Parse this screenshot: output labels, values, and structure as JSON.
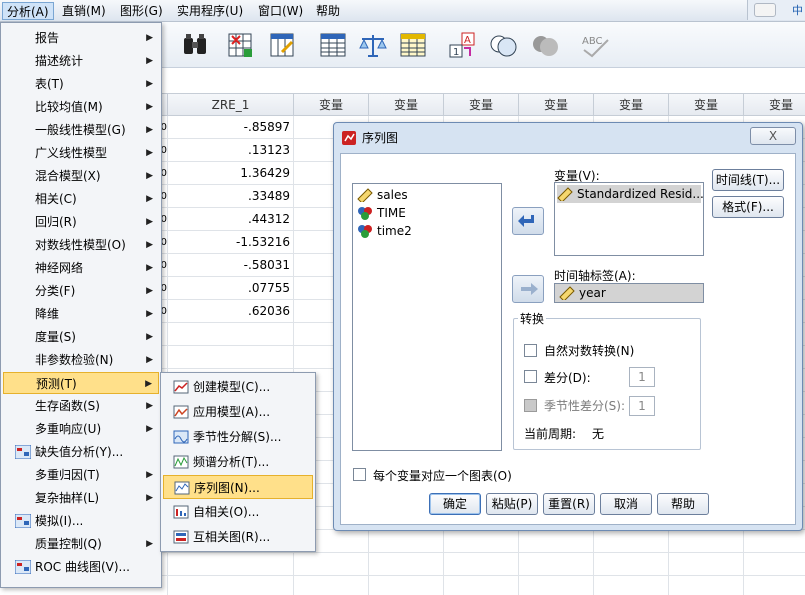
{
  "menubar": {
    "items": [
      {
        "label": "分析(A)"
      },
      {
        "label": "直销(M)"
      },
      {
        "label": "图形(G)"
      },
      {
        "label": "实用程序(U)"
      },
      {
        "label": "窗口(W)"
      },
      {
        "label": "帮助"
      }
    ],
    "right_tag": "中"
  },
  "grid": {
    "columns": [
      "ZRE_1",
      "变量",
      "变量",
      "变量",
      "变量",
      "变量",
      "变量",
      "变量"
    ],
    "zre_values": [
      "-.85897",
      ".13123",
      "1.36429",
      ".33489",
      ".44312",
      "-1.53216",
      "-.58031",
      ".07755",
      ".62036"
    ],
    "left_col_values": [
      "0",
      "0",
      "0",
      "0",
      "0",
      "0",
      "0",
      "0",
      "0"
    ]
  },
  "analyze_menu": {
    "items": [
      {
        "label": "报告",
        "submenu": true
      },
      {
        "label": "描述统计",
        "submenu": true
      },
      {
        "label": "表(T)",
        "submenu": true
      },
      {
        "label": "比较均值(M)",
        "submenu": true
      },
      {
        "label": "一般线性模型(G)",
        "submenu": true
      },
      {
        "label": "广义线性模型",
        "submenu": true
      },
      {
        "label": "混合模型(X)",
        "submenu": true
      },
      {
        "label": "相关(C)",
        "submenu": true
      },
      {
        "label": "回归(R)",
        "submenu": true
      },
      {
        "label": "对数线性模型(O)",
        "submenu": true
      },
      {
        "label": "神经网络",
        "submenu": true
      },
      {
        "label": "分类(F)",
        "submenu": true
      },
      {
        "label": "降维",
        "submenu": true
      },
      {
        "label": "度量(S)",
        "submenu": true
      },
      {
        "label": "非参数检验(N)",
        "submenu": true
      },
      {
        "label": "预测(T)",
        "submenu": true
      },
      {
        "label": "生存函数(S)",
        "submenu": true
      },
      {
        "label": "多重响应(U)",
        "submenu": true
      },
      {
        "label": "缺失值分析(Y)...",
        "submenu": false
      },
      {
        "label": "多重归因(T)",
        "submenu": true
      },
      {
        "label": "复杂抽样(L)",
        "submenu": true
      },
      {
        "label": "模拟(I)...",
        "submenu": false
      },
      {
        "label": "质量控制(Q)",
        "submenu": true
      },
      {
        "label": "ROC 曲线图(V)...",
        "submenu": false
      }
    ]
  },
  "forecast_submenu": {
    "items": [
      {
        "label": "创建模型(C)..."
      },
      {
        "label": "应用模型(A)..."
      },
      {
        "label": "季节性分解(S)..."
      },
      {
        "label": "频谱分析(T)..."
      },
      {
        "label": "序列图(N)..."
      },
      {
        "label": "自相关(O)..."
      },
      {
        "label": "互相关图(R)..."
      }
    ]
  },
  "dialog": {
    "title": "序列图",
    "close_label": "X",
    "source_vars": [
      "sales",
      "TIME",
      "time2"
    ],
    "variables_label": "变量(V):",
    "variables_value": "Standardized Resid...",
    "time_axis_label": "时间轴标签(A):",
    "time_axis_value": "year",
    "time_lines_button": "时间线(T)...",
    "format_button": "格式(F)...",
    "transform": {
      "title": "转换",
      "natural_log": "自然对数转换(N)",
      "difference": "差分(D):",
      "difference_value": "1",
      "seasonal_diff": "季节性差分(S):",
      "seasonal_value": "1",
      "current_period_label": "当前周期:",
      "current_period_value": "无"
    },
    "one_chart_per_var": "每个变量对应一个图表(O)",
    "buttons": {
      "ok": "确定",
      "paste": "粘贴(P)",
      "reset": "重置(R)",
      "cancel": "取消",
      "help": "帮助"
    }
  }
}
